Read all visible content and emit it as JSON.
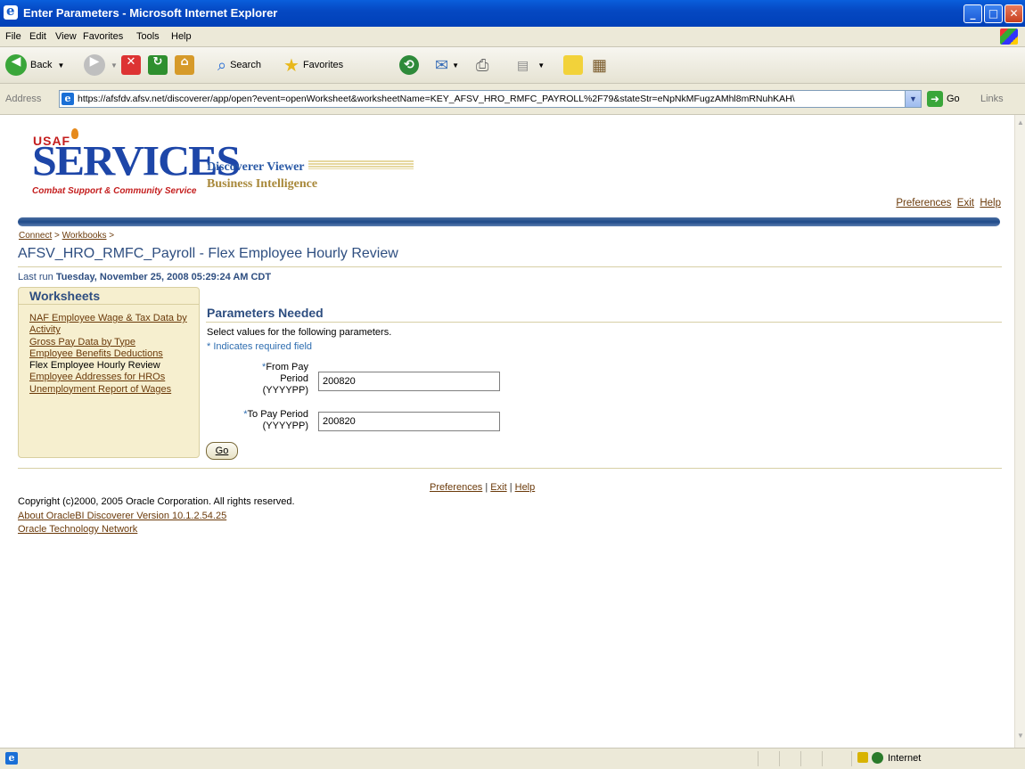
{
  "window": {
    "title": "Enter Parameters - Microsoft Internet Explorer",
    "min": "_",
    "max": "□",
    "close": "✕"
  },
  "menu": [
    "File",
    "Edit",
    "View",
    "Favorites",
    "Tools",
    "Help"
  ],
  "toolbar": {
    "back": "Back",
    "search": "Search",
    "favorites": "Favorites"
  },
  "address": {
    "label": "Address",
    "url": "https://afsfdv.afsv.net/discoverer/app/open?event=openWorksheet&worksheetName=KEY_AFSV_HRO_RMFC_PAYROLL%2F79&stateStr=eNpNkMFugzAMhl8mRNuhKAH\\",
    "go": "Go",
    "links": "Links"
  },
  "logo": {
    "usaf": "USAF",
    "services": "SERVICES",
    "tagline": "Combat Support & Community Service",
    "product": "Discoverer Viewer",
    "subtitle": "Business Intelligence"
  },
  "toplinks": {
    "preferences": "Preferences",
    "exit": "Exit",
    "help": "Help"
  },
  "breadcrumb": {
    "connect": "Connect",
    "sep": ">",
    "workbooks": "Workbooks"
  },
  "page_title": "AFSV_HRO_RMFC_Payroll - Flex Employee Hourly Review",
  "last_run": {
    "label": "Last run",
    "value": "Tuesday, November 25, 2008 05:29:24 AM CDT"
  },
  "worksheets": {
    "header": "Worksheets",
    "items": [
      {
        "label": "NAF Employee Wage & Tax Data by Activity",
        "current": false
      },
      {
        "label": "Gross Pay Data by Type",
        "current": false
      },
      {
        "label": "Employee Benefits Deductions",
        "current": false
      },
      {
        "label": "Flex Employee Hourly Review",
        "current": true
      },
      {
        "label": "Employee Addresses for HROs",
        "current": false
      },
      {
        "label": "Unemployment Report of Wages",
        "current": false
      }
    ]
  },
  "params": {
    "heading": "Parameters Needed",
    "instructions": "Select values for the following parameters.",
    "required_note": "* Indicates required field",
    "from": {
      "l1": "From Pay",
      "l2": "Period",
      "l3": "(YYYYPP)",
      "value": "200820"
    },
    "to": {
      "l1": "To Pay Period",
      "l2": "(YYYYPP)",
      "value": "200820"
    },
    "go": "Go"
  },
  "footer": {
    "preferences": "Preferences",
    "exit": "Exit",
    "help": "Help",
    "sep": "|",
    "copyright": "Copyright (c)2000, 2005 Oracle Corporation. All rights reserved.",
    "about": "About OracleBI Discoverer Version 10.1.2.54.25",
    "otn": "Oracle Technology Network"
  },
  "status": {
    "zone": "Internet"
  }
}
